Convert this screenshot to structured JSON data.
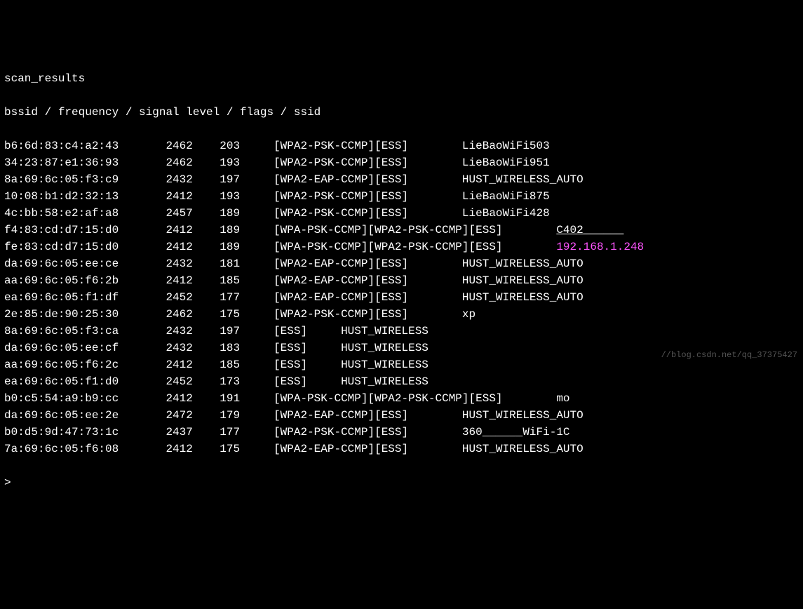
{
  "title": "scan_results",
  "header": "bssid / frequency / signal level / flags / ssid",
  "prompt": ">",
  "watermark": "//blog.csdn.net/qq_37375427",
  "rows": [
    {
      "bssid": "b6:6d:83:c4:a2:43",
      "freq": "2462",
      "sig": "203",
      "flags": "[WPA2-PSK-CCMP][ESS]",
      "ssid": "LieBaoWiFi503",
      "ssid_color": "white",
      "ssid_ul": false
    },
    {
      "bssid": "34:23:87:e1:36:93",
      "freq": "2462",
      "sig": "193",
      "flags": "[WPA2-PSK-CCMP][ESS]",
      "ssid": "LieBaoWiFi951",
      "ssid_color": "white",
      "ssid_ul": false
    },
    {
      "bssid": "8a:69:6c:05:f3:c9",
      "freq": "2432",
      "sig": "197",
      "flags": "[WPA2-EAP-CCMP][ESS]",
      "ssid": "HUST_WIRELESS_AUTO",
      "ssid_color": "white",
      "ssid_ul": false
    },
    {
      "bssid": "10:08:b1:d2:32:13",
      "freq": "2412",
      "sig": "193",
      "flags": "[WPA2-PSK-CCMP][ESS]",
      "ssid": "LieBaoWiFi875",
      "ssid_color": "white",
      "ssid_ul": false
    },
    {
      "bssid": "4c:bb:58:e2:af:a8",
      "freq": "2457",
      "sig": "189",
      "flags": "[WPA2-PSK-CCMP][ESS]",
      "ssid": "LieBaoWiFi428",
      "ssid_color": "white",
      "ssid_ul": false
    },
    {
      "bssid": "f4:83:cd:d7:15:d0",
      "freq": "2412",
      "sig": "189",
      "flags": "[WPA-PSK-CCMP][WPA2-PSK-CCMP][ESS]",
      "ssid": "C402______",
      "ssid_color": "white",
      "ssid_ul": true
    },
    {
      "bssid": "fe:83:cd:d7:15:d0",
      "freq": "2412",
      "sig": "189",
      "flags": "[WPA-PSK-CCMP][WPA2-PSK-CCMP][ESS]",
      "ssid": "192.168.1.248",
      "ssid_color": "magenta",
      "ssid_ul": false
    },
    {
      "bssid": "da:69:6c:05:ee:ce",
      "freq": "2432",
      "sig": "181",
      "flags": "[WPA2-EAP-CCMP][ESS]",
      "ssid": "HUST_WIRELESS_AUTO",
      "ssid_color": "white",
      "ssid_ul": false
    },
    {
      "bssid": "aa:69:6c:05:f6:2b",
      "freq": "2412",
      "sig": "185",
      "flags": "[WPA2-EAP-CCMP][ESS]",
      "ssid": "HUST_WIRELESS_AUTO",
      "ssid_color": "white",
      "ssid_ul": false
    },
    {
      "bssid": "ea:69:6c:05:f1:df",
      "freq": "2452",
      "sig": "177",
      "flags": "[WPA2-EAP-CCMP][ESS]",
      "ssid": "HUST_WIRELESS_AUTO",
      "ssid_color": "white",
      "ssid_ul": false
    },
    {
      "bssid": "2e:85:de:90:25:30",
      "freq": "2462",
      "sig": "175",
      "flags": "[WPA2-PSK-CCMP][ESS]",
      "ssid": "xp",
      "ssid_color": "white",
      "ssid_ul": false
    },
    {
      "bssid": "8a:69:6c:05:f3:ca",
      "freq": "2432",
      "sig": "197",
      "flags": "[ESS]",
      "ssid": "HUST_WIRELESS",
      "ssid_color": "white",
      "ssid_ul": false
    },
    {
      "bssid": "da:69:6c:05:ee:cf",
      "freq": "2432",
      "sig": "183",
      "flags": "[ESS]",
      "ssid": "HUST_WIRELESS",
      "ssid_color": "white",
      "ssid_ul": false
    },
    {
      "bssid": "aa:69:6c:05:f6:2c",
      "freq": "2412",
      "sig": "185",
      "flags": "[ESS]",
      "ssid": "HUST_WIRELESS",
      "ssid_color": "white",
      "ssid_ul": false
    },
    {
      "bssid": "ea:69:6c:05:f1:d0",
      "freq": "2452",
      "sig": "173",
      "flags": "[ESS]",
      "ssid": "HUST_WIRELESS",
      "ssid_color": "white",
      "ssid_ul": false
    },
    {
      "bssid": "b0:c5:54:a9:b9:cc",
      "freq": "2412",
      "sig": "191",
      "flags": "[WPA-PSK-CCMP][WPA2-PSK-CCMP][ESS]",
      "ssid": "mo",
      "ssid_color": "white",
      "ssid_ul": false
    },
    {
      "bssid": "da:69:6c:05:ee:2e",
      "freq": "2472",
      "sig": "179",
      "flags": "[WPA2-EAP-CCMP][ESS]",
      "ssid": "HUST_WIRELESS_AUTO",
      "ssid_color": "white",
      "ssid_ul": false
    },
    {
      "bssid": "b0:d5:9d:47:73:1c",
      "freq": "2437",
      "sig": "177",
      "flags": "[WPA2-PSK-CCMP][ESS]",
      "ssid": "360______WiFi-1C",
      "ssid_color": "white",
      "ssid_ul": false
    },
    {
      "bssid": "7a:69:6c:05:f6:08",
      "freq": "2412",
      "sig": "175",
      "flags": "[WPA2-EAP-CCMP][ESS]",
      "ssid": "HUST_WIRELESS_AUTO",
      "ssid_color": "white",
      "ssid_ul": false
    }
  ]
}
